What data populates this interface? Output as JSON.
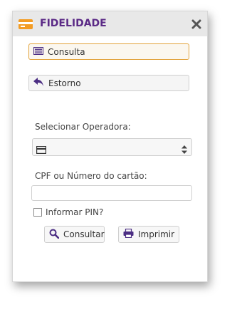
{
  "panel": {
    "title": "FIDELIDADE",
    "icon": "credit-card-icon",
    "close_icon": "close-icon"
  },
  "actions": {
    "consulta_label": "Consulta",
    "estorno_label": "Estorno"
  },
  "form": {
    "operadora_label": "Selecionar Operadora:",
    "operadora_value": "",
    "cpf_label": "CPF ou Número do cartão:",
    "cpf_value": "",
    "pin_label": "Informar PIN?",
    "pin_checked": false
  },
  "buttons": {
    "consultar_label": "Consultar",
    "imprimir_label": "Imprimir"
  },
  "colors": {
    "accent_orange": "#f39c24",
    "title_purple": "#5b2a86",
    "icon_purple": "#4b2d83"
  }
}
